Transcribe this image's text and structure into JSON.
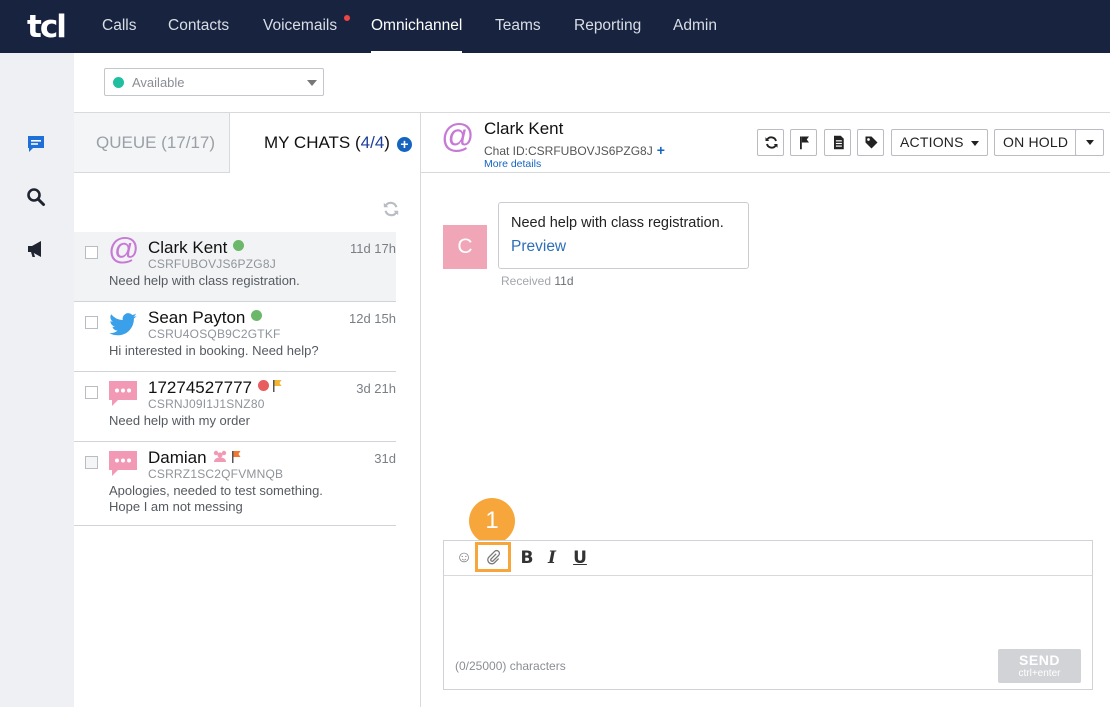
{
  "nav": {
    "logo": "tcl",
    "items": [
      {
        "label": "Calls",
        "active": false,
        "dot": false
      },
      {
        "label": "Contacts",
        "active": false,
        "dot": false
      },
      {
        "label": "Voicemails",
        "active": false,
        "dot": true
      },
      {
        "label": "Omnichannel",
        "active": true,
        "dot": false
      },
      {
        "label": "Teams",
        "active": false,
        "dot": false
      },
      {
        "label": "Reporting",
        "active": false,
        "dot": false
      },
      {
        "label": "Admin",
        "active": false,
        "dot": false
      }
    ]
  },
  "rail": {
    "icons": [
      "chat-icon",
      "search-icon",
      "megaphone-icon"
    ]
  },
  "status": {
    "value": "Available",
    "color": "#1fbfa0"
  },
  "tabs": {
    "queue_label": "QUEUE (17/17)",
    "mychats_label": "MY CHATS (",
    "mychats_count": "4/4",
    "mychats_close": ")"
  },
  "chats": [
    {
      "name": "Clark Kent",
      "id": "CSRFUBOVJS6PZG8J",
      "preview": "Need help with class registration.",
      "time": "11d 17h",
      "channel": "email",
      "status_color": "#6cb86a",
      "flag": null,
      "selected": true
    },
    {
      "name": "Sean Payton",
      "id": "CSRU4OSQB9C2GTKF",
      "preview": "Hi interested in booking. Need help?",
      "time": "12d 15h",
      "channel": "twitter",
      "status_color": "#6cb86a",
      "flag": null,
      "selected": false
    },
    {
      "name": "17274527777",
      "id": "CSRNJ09I1J1SNZ80",
      "preview": "Need help with my order",
      "time": "3d 21h",
      "channel": "sms",
      "status_color": "#e85d5d",
      "flag": "#f2b632",
      "selected": false
    },
    {
      "name": "Damian",
      "id": "CSRRZ1SC2QFVMNQB",
      "preview": "Apologies, needed to test something. Hope I am not messing",
      "time": "31d",
      "channel": "sms",
      "status_color": null,
      "flag": "#f0782e",
      "group": true,
      "selected": false
    }
  ],
  "header": {
    "name": "Clark Kent",
    "chat_id": "Chat ID:CSRFUBOVJS6PZG8J",
    "more": "More details",
    "actions_label": "ACTIONS",
    "hold_label": "ON HOLD"
  },
  "message": {
    "avatar": "C",
    "text": "Need help with class registration.",
    "link": "Preview",
    "received_label": "Received",
    "received_value": "11d"
  },
  "composer": {
    "step": "1",
    "charcount": "(0/25000) characters",
    "send_label": "SEND",
    "send_hint": "ctrl+enter",
    "bold": "B",
    "italic": "I",
    "underline": "U"
  },
  "colors": {
    "nav_bg": "#18243f",
    "accent": "#1565c0",
    "highlight": "#f7a63b"
  }
}
